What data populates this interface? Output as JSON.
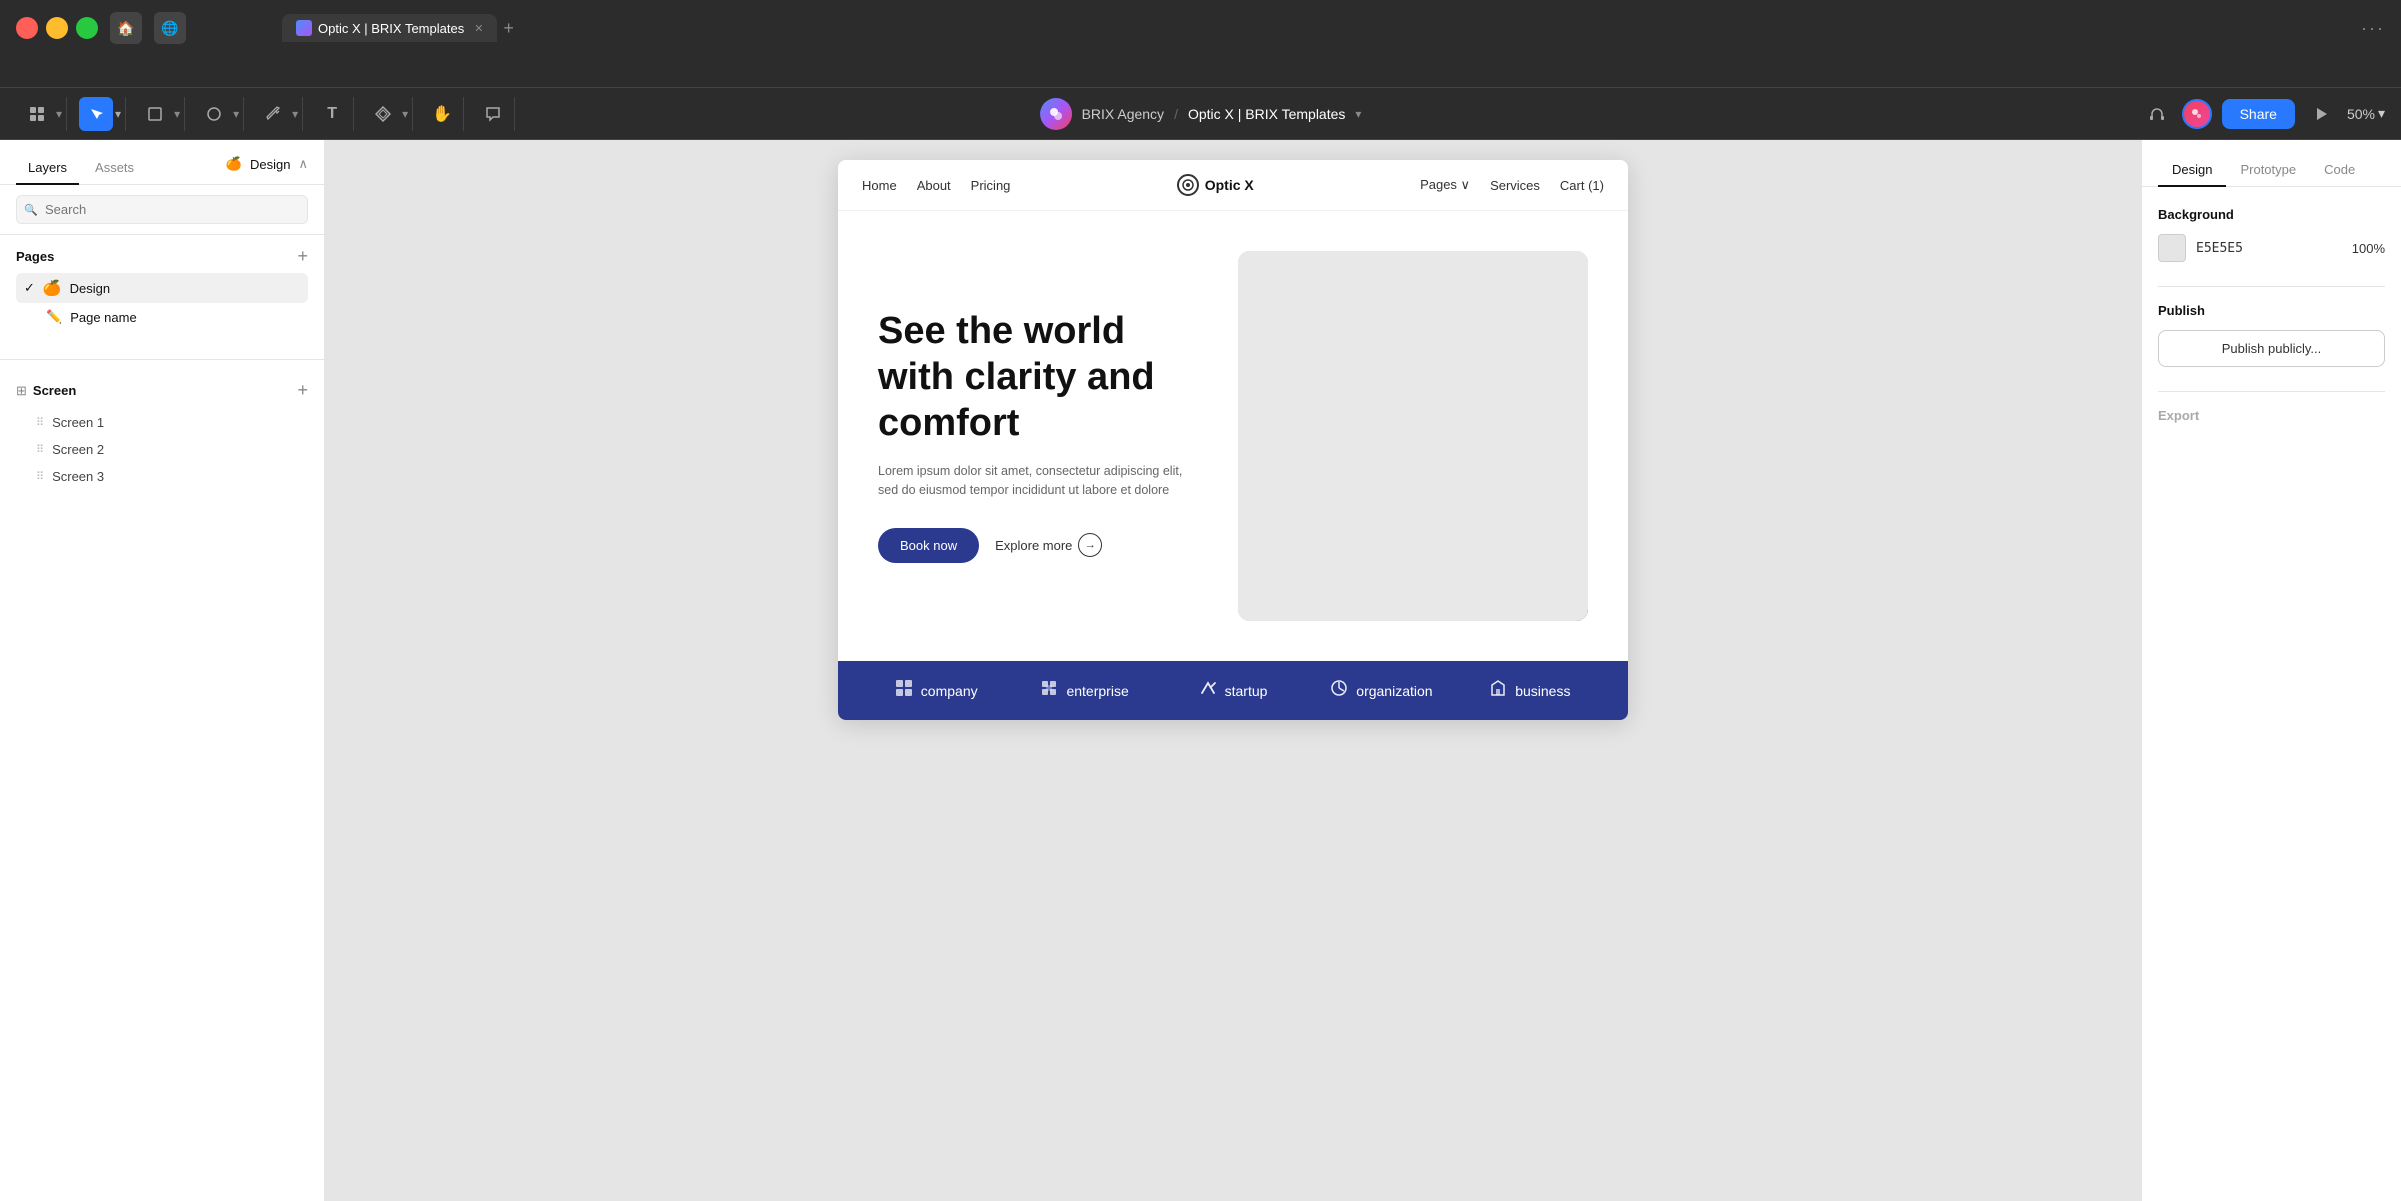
{
  "browser": {
    "traffic_lights": [
      "red",
      "yellow",
      "green"
    ],
    "tab_label": "Optic X | BRIX Templates",
    "tab_add": "+",
    "more_label": "···"
  },
  "toolbar": {
    "breadcrumb_agency": "BRIX Agency",
    "breadcrumb_sep": "/",
    "breadcrumb_page": "Optic X | BRIX Templates",
    "share_label": "Share",
    "zoom_label": "50%",
    "tools": [
      {
        "name": "grid-tool",
        "label": "⊞",
        "active": false
      },
      {
        "name": "select-tool",
        "label": "▶",
        "active": true
      },
      {
        "name": "frame-tool",
        "label": "⬜",
        "active": false
      },
      {
        "name": "shape-tool",
        "label": "◯",
        "active": false
      },
      {
        "name": "pen-tool",
        "label": "✒",
        "active": false
      },
      {
        "name": "text-tool",
        "label": "T",
        "active": false
      },
      {
        "name": "component-tool",
        "label": "❖",
        "active": false
      },
      {
        "name": "hand-tool",
        "label": "✋",
        "active": false
      },
      {
        "name": "comment-tool",
        "label": "💬",
        "active": false
      }
    ]
  },
  "left_panel": {
    "tabs": [
      "Layers",
      "Assets"
    ],
    "active_tab": "Layers",
    "design_label": "🍊 Design",
    "search_placeholder": "Search",
    "pages_section": {
      "title": "Pages",
      "add_label": "+",
      "items": [
        {
          "label": "🍊 Design",
          "active": true,
          "check": "✓"
        },
        {
          "label": "Page name",
          "icon": "✏️"
        }
      ]
    },
    "screen_section": {
      "title": "Screen",
      "add_label": "+",
      "items": [
        "Screen 1",
        "Screen 2",
        "Screen 3"
      ]
    }
  },
  "canvas": {
    "site_nav": {
      "links": [
        "Home",
        "About",
        "Pricing"
      ],
      "logo": "Optic X",
      "right_links": [
        "Pages ∨",
        "Services",
        "Cart (1)"
      ]
    },
    "hero": {
      "title": "See the world with clarity and comfort",
      "subtitle": "Lorem ipsum dolor sit amet, consectetur adipiscing elit, sed do eiusmod tempor incididunt ut labore et dolore",
      "btn_primary": "Book now",
      "btn_explore": "Explore more"
    },
    "categories": [
      {
        "icon": "⊞",
        "label": "company"
      },
      {
        "icon": "⊞",
        "label": "enterprise"
      },
      {
        "icon": "↗",
        "label": "startup"
      },
      {
        "icon": "↺",
        "label": "organization"
      },
      {
        "icon": "◆",
        "label": "business"
      }
    ]
  },
  "right_panel": {
    "tabs": [
      "Design",
      "Prototype",
      "Code"
    ],
    "active_tab": "Design",
    "background_section": {
      "title": "Background",
      "color": "E5E5E5",
      "opacity": "100%"
    },
    "publish_section": {
      "title": "Publish",
      "btn_label": "Publish publicly..."
    },
    "export_section": {
      "title": "Export"
    }
  }
}
